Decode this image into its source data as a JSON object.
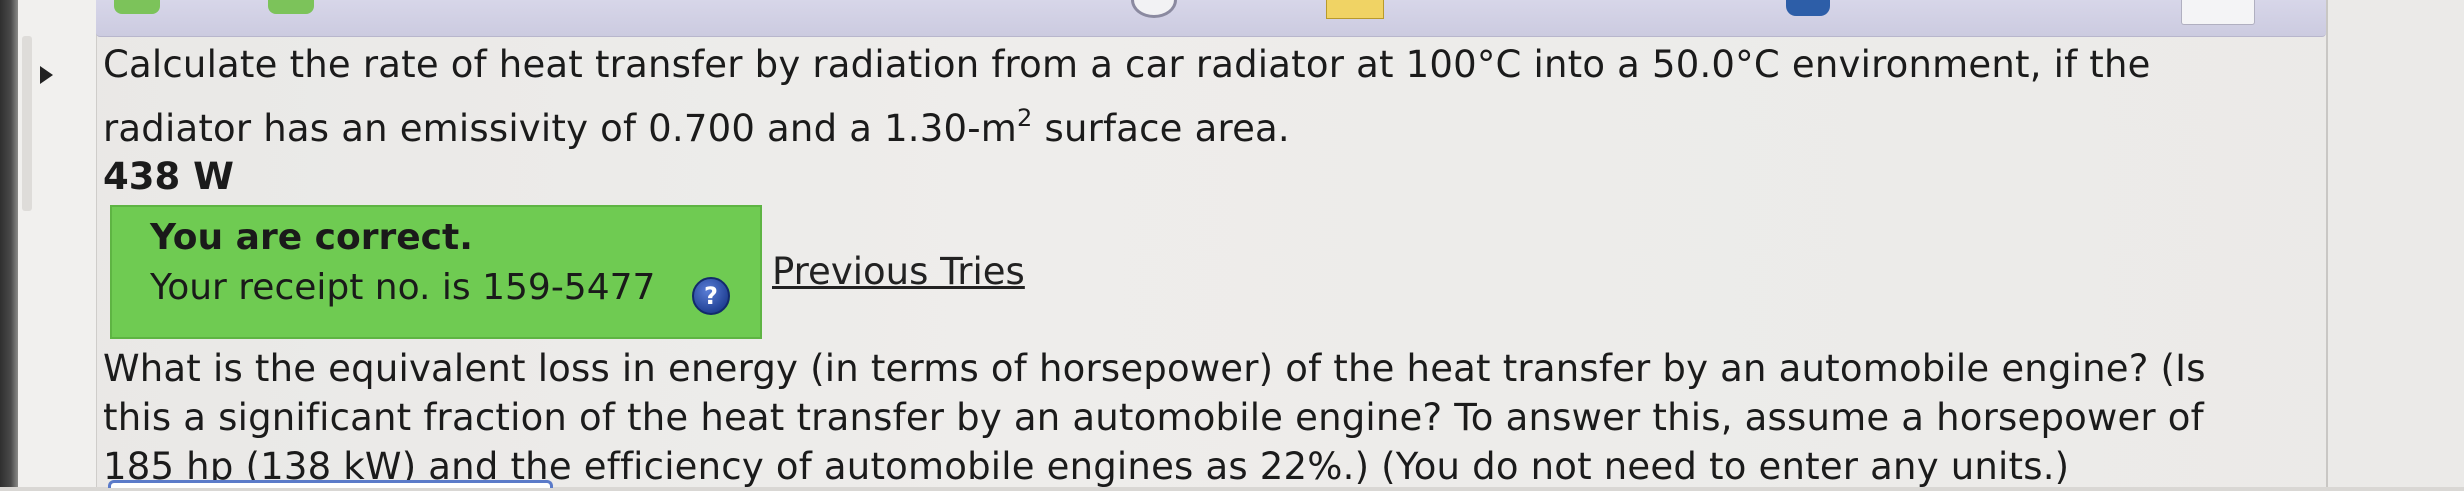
{
  "question": {
    "part1_line1": "Calculate the rate of heat transfer by radiation from a car radiator at 100°C into a 50.0°C environment, if the",
    "part1_line2_a": "radiator has an emissivity of 0.700 and a 1.30-m",
    "part1_line2_sup": "2",
    "part1_line2_b": " surface area.",
    "answer": "438 W",
    "feedback": {
      "title": "You are correct.",
      "receipt": "Your receipt no. is 159-5477",
      "help_symbol": "?"
    },
    "previous_tries": "Previous Tries",
    "part2_lines": [
      "What is the equivalent loss in energy (in terms of horsepower) of the heat transfer by an automobile engine? (Is",
      "this a significant fraction of the heat transfer by an automobile engine? To answer this, assume a horsepower of",
      "185 hp (138 kW) and the efficiency of automobile engines as 22%.) (You do not need to enter any units.)"
    ]
  },
  "colors": {
    "correct_bg": "#6fcb52",
    "help_icon": "#1f3f93",
    "toolbar": "#d7d6e9",
    "nav_arrow": "#7cc35a"
  },
  "icons": [
    "collapse-triangle-icon",
    "help-icon",
    "back-arrow-icon",
    "forward-arrow-icon"
  ]
}
